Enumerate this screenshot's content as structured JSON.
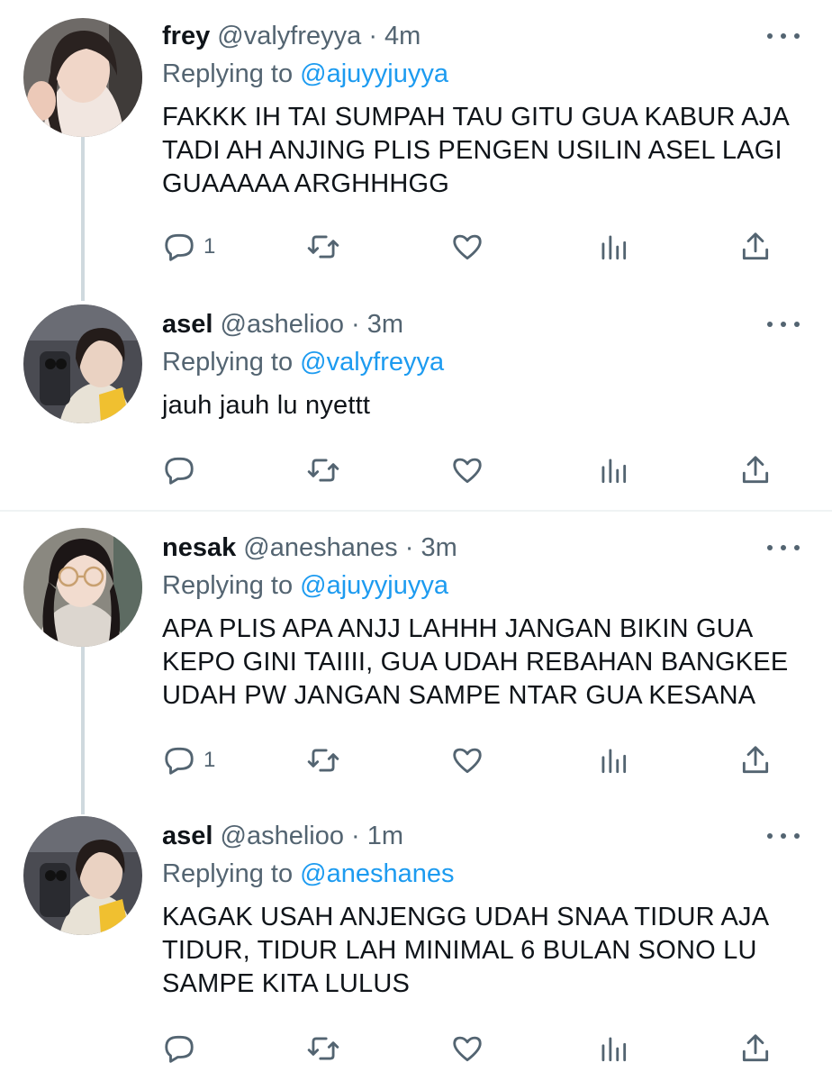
{
  "tweets": [
    {
      "name": "frey",
      "handle": "@valyfreyya",
      "dot": "·",
      "time": "4m",
      "replying_label": "Replying to",
      "replying_to": "@ajuyyjuyya",
      "text": "FAKKK IH TAI SUMPAH TAU GITU GUA KABUR AJA TADI AH ANJING PLIS PENGEN USILIN ASEL LAGI GUAAAAA ARGHHHGG",
      "reply_count": "1",
      "avatar_icon": "avatar-frey"
    },
    {
      "name": "asel",
      "handle": "@ashelioo",
      "dot": "·",
      "time": "3m",
      "replying_label": "Replying to",
      "replying_to": "@valyfreyya",
      "text": "jauh jauh lu nyettt",
      "reply_count": "",
      "avatar_icon": "avatar-asel"
    },
    {
      "name": "nesak",
      "handle": "@aneshanes",
      "dot": "·",
      "time": "3m",
      "replying_label": "Replying to",
      "replying_to": "@ajuyyjuyya",
      "text": "APA PLIS APA ANJJ LAHHH JANGAN BIKIN GUA KEPO GINI TAIIII, GUA UDAH REBAHAN BANGKEE UDAH PW JANGAN SAMPE NTAR GUA KESANA",
      "reply_count": "1",
      "avatar_icon": "avatar-nesak"
    },
    {
      "name": "asel",
      "handle": "@ashelioo",
      "dot": "·",
      "time": "1m",
      "replying_label": "Replying to",
      "replying_to": "@aneshanes",
      "text": "KAGAK USAH ANJENGG UDAH SNAA TIDUR AJA TIDUR, TIDUR LAH MINIMAL 6 BULAN SONO LU SAMPE KITA LULUS",
      "reply_count": "",
      "avatar_icon": "avatar-asel"
    }
  ],
  "colors": {
    "text": "#0f1419",
    "secondary": "#536471",
    "link": "#1d9bf0",
    "thread_line": "#cfd9de",
    "divider": "#eff3f4"
  }
}
